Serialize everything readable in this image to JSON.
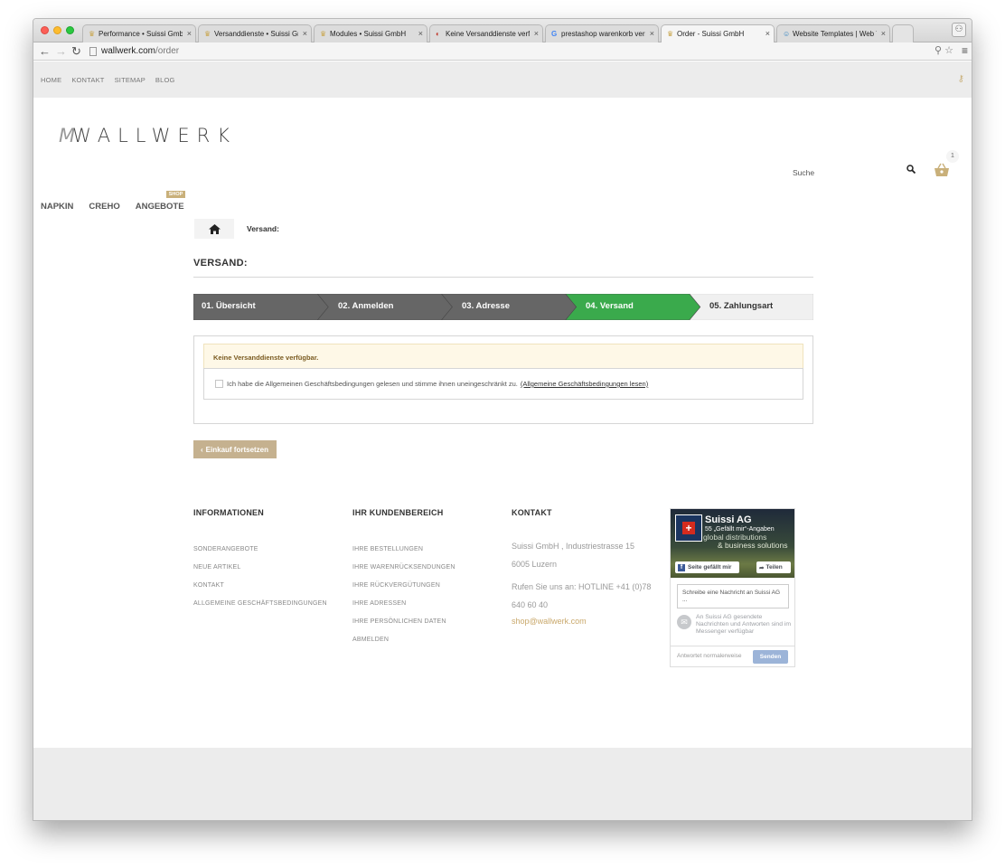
{
  "browser": {
    "tabs": [
      {
        "label": "Performance • Suissi GmbH",
        "active": false
      },
      {
        "label": "Versanddienste • Suissi GmbH",
        "active": false
      },
      {
        "label": "Modules • Suissi GmbH",
        "active": false
      },
      {
        "label": "Keine Versanddienste verfügbar",
        "active": false
      },
      {
        "label": "prestashop warenkorb versand",
        "active": false
      },
      {
        "label": "Order - Suissi GmbH",
        "active": true
      },
      {
        "label": "Website Templates | Web Templates",
        "active": false
      }
    ],
    "url_host": "wallwerk.com",
    "url_path": "/order"
  },
  "topnav": {
    "items": [
      "HOME",
      "KONTAKT",
      "SITEMAP",
      "BLOG"
    ]
  },
  "header": {
    "logo_mark": "M",
    "logo_text": "WALLWERK",
    "search_label": "Suche",
    "cart_count": "1"
  },
  "mainnav": {
    "items": [
      "NAPKIN",
      "CREHO",
      "ANGEBOTE"
    ],
    "badge": "SHOP"
  },
  "breadcrumb": {
    "current": "Versand:"
  },
  "heading": "VERSAND:",
  "steps": [
    {
      "label": "01. Übersicht",
      "state": "done"
    },
    {
      "label": "02. Anmelden",
      "state": "done"
    },
    {
      "label": "03. Adresse",
      "state": "done"
    },
    {
      "label": "04. Versand",
      "state": "current"
    },
    {
      "label": "05. Zahlungsart",
      "state": "todo"
    }
  ],
  "colors": {
    "done": "#666666",
    "current": "#3aaa4c",
    "todo": "#f0f0f0",
    "accent": "#c5b18f"
  },
  "shipping": {
    "alert": "Keine Versanddienste verfügbar.",
    "terms_text": "Ich habe die Allgemeinen Geschäftsbedingungen gelesen und stimme ihnen uneingeschränkt zu.",
    "terms_link": "(Allgemeine Geschäftsbedingungen lesen)"
  },
  "continue_button": "Einkauf fortsetzen",
  "footer": {
    "info": {
      "title": "INFORMATIONEN",
      "links": [
        "SONDERANGEBOTE",
        "NEUE ARTIKEL",
        "KONTAKT",
        "ALLGEMEINE GESCHÄFTSBEDINGUNGEN"
      ]
    },
    "account": {
      "title": "IHR KUNDENBEREICH",
      "links": [
        "IHRE BESTELLUNGEN",
        "IHRE WARENRÜCKSENDUNGEN",
        "IHRE RÜCKVERGÜTUNGEN",
        "IHRE ADRESSEN",
        "IHRE PERSÖNLICHEN DATEN",
        "ABMELDEN"
      ]
    },
    "contact": {
      "title": "KONTAKT",
      "address1": "Suissi GmbH , Industriestrasse 15",
      "address2": "6005 Luzern",
      "phone1": "Rufen Sie uns an: HOTLINE +41 (0)78",
      "phone2": "640 60 40",
      "email": "shop@wallwerk.com"
    }
  },
  "facebook": {
    "page_name": "Suissi AG",
    "likes": "55 „Gefällt mir“-Angaben",
    "slogan1": "global distributions",
    "slogan2": "& business solutions",
    "like_button": "Seite gefällt mir",
    "share_button": "Teilen",
    "message_placeholder": "Schreibe eine Nachricht an Suissi AG ...",
    "messenger_note": "An Suissi AG gesendete Nachrichten und Antworten sind im Messenger verfügbar",
    "reply_placeholder": "Antwortet normalerweise",
    "send_button": "Senden"
  }
}
